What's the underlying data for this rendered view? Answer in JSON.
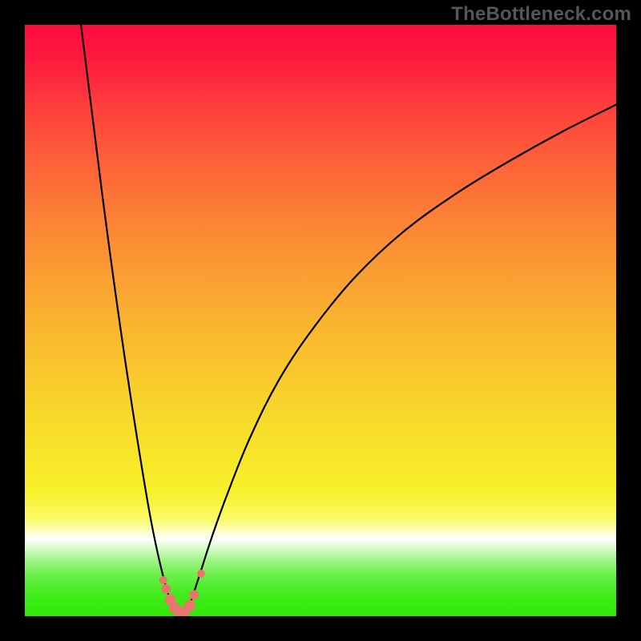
{
  "watermark": "TheBottleneck.com",
  "chart_data": {
    "type": "line",
    "title": "",
    "xlabel": "",
    "ylabel": "",
    "xlim": [
      0,
      100
    ],
    "ylim": [
      0,
      100
    ],
    "grid": false,
    "background": "rainbow-vertical-gradient",
    "series": [
      {
        "name": "left-curve",
        "x": [
          9.5,
          11,
          13,
          15,
          17,
          19,
          21,
          22.5,
          24,
          25,
          25.8
        ],
        "y": [
          100,
          88,
          72,
          57,
          43,
          30,
          18,
          10.5,
          4.5,
          1.8,
          0.6
        ]
      },
      {
        "name": "right-curve",
        "x": [
          27.2,
          28,
          29.5,
          31.5,
          34,
          38,
          43,
          49,
          56,
          64,
          73,
          82,
          91,
          100
        ],
        "y": [
          0.6,
          2.3,
          6.8,
          13,
          20,
          30,
          40,
          49,
          57.5,
          65,
          71.5,
          77,
          82,
          86.5
        ]
      },
      {
        "name": "valley-floor",
        "x": [
          25.8,
          27.2
        ],
        "y": [
          0.6,
          0.6
        ]
      }
    ],
    "markers": {
      "name": "valley-markers",
      "color": "#e9756c",
      "points": [
        {
          "x": 23.4,
          "y": 6.1,
          "r": 5
        },
        {
          "x": 23.9,
          "y": 4.6,
          "r": 6
        },
        {
          "x": 24.6,
          "y": 2.8,
          "r": 7
        },
        {
          "x": 25.3,
          "y": 1.4,
          "r": 7
        },
        {
          "x": 26.1,
          "y": 0.8,
          "r": 7
        },
        {
          "x": 27.0,
          "y": 0.8,
          "r": 7
        },
        {
          "x": 27.9,
          "y": 1.8,
          "r": 7
        },
        {
          "x": 28.6,
          "y": 3.6,
          "r": 6
        },
        {
          "x": 29.8,
          "y": 7.2,
          "r": 5
        }
      ]
    }
  }
}
